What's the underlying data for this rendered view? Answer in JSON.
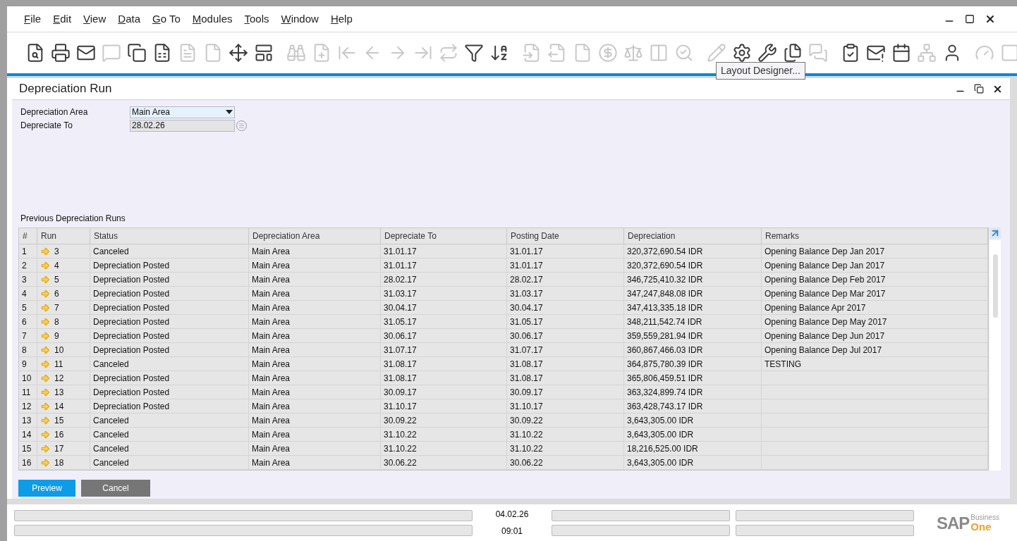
{
  "menu": [
    "File",
    "Edit",
    "View",
    "Data",
    "Go To",
    "Modules",
    "Tools",
    "Window",
    "Help"
  ],
  "toolbar": [
    [
      {
        "disabled": false
      },
      {
        "disabled": false
      },
      {
        "disabled": false
      },
      {
        "disabled": true
      },
      {
        "disabled": false
      },
      {
        "disabled": false
      },
      {
        "disabled": true
      },
      {
        "disabled": true
      },
      {
        "disabled": false
      },
      {
        "disabled": false
      }
    ],
    [
      {
        "disabled": true
      },
      {
        "disabled": true
      },
      {
        "disabled": true
      },
      {
        "disabled": true
      },
      {
        "disabled": true
      },
      {
        "disabled": true
      },
      {
        "disabled": true
      },
      {
        "disabled": false
      },
      {
        "disabled": false
      }
    ],
    [
      {
        "disabled": true
      },
      {
        "disabled": true
      },
      {
        "disabled": true
      },
      {
        "disabled": true
      },
      {
        "disabled": true
      },
      {
        "disabled": true
      },
      {
        "disabled": true
      }
    ],
    [
      {
        "disabled": true
      },
      {
        "disabled": false
      },
      {
        "disabled": false
      },
      {
        "disabled": false
      },
      {
        "disabled": true
      }
    ],
    [
      {
        "disabled": false
      },
      {
        "disabled": false
      },
      {
        "disabled": false
      },
      {
        "disabled": true
      },
      {
        "disabled": false
      }
    ],
    [
      {
        "disabled": true
      },
      {
        "disabled": true
      }
    ]
  ],
  "tooltip": "Layout Designer...",
  "form": {
    "title": "Depreciation Run",
    "fields": [
      {
        "kind": "dropdown",
        "label": "Depreciation Area",
        "value": "Main Area"
      },
      {
        "kind": "date",
        "label": "Depreciate To",
        "value": "28.02.26"
      }
    ],
    "table_title": "Previous Depreciation Runs",
    "columns": [
      "#",
      "Run",
      "Status",
      "Depreciation Area",
      "Depreciate To",
      "Posting Date",
      "Depreciation",
      "Remarks"
    ],
    "rows": [
      [
        "1",
        "3",
        "Canceled",
        "Main Area",
        "31.01.17",
        "31.01.17",
        "320,372,690.54 IDR",
        "Opening Balance Dep Jan 2017"
      ],
      [
        "2",
        "4",
        "Depreciation Posted",
        "Main Area",
        "31.01.17",
        "31.01.17",
        "320,372,690.54 IDR",
        "Opening Balance Dep Jan 2017"
      ],
      [
        "3",
        "5",
        "Depreciation Posted",
        "Main Area",
        "28.02.17",
        "28.02.17",
        "346,725,410.32 IDR",
        "Opening Balance Dep Feb 2017"
      ],
      [
        "4",
        "6",
        "Depreciation Posted",
        "Main Area",
        "31.03.17",
        "31.03.17",
        "347,247,848.08 IDR",
        "Opening Balance Dep Mar 2017"
      ],
      [
        "5",
        "7",
        "Depreciation Posted",
        "Main Area",
        "30.04.17",
        "30.04.17",
        "347,413,335.18 IDR",
        "Opening Balance Apr 2017"
      ],
      [
        "6",
        "8",
        "Depreciation Posted",
        "Main Area",
        "31.05.17",
        "31.05.17",
        "348,211,542.74 IDR",
        "Opening Balance Dep May 2017"
      ],
      [
        "7",
        "9",
        "Depreciation Posted",
        "Main Area",
        "30.06.17",
        "30.06.17",
        "359,559,281.94 IDR",
        "Opening Balance Dep Jun 2017"
      ],
      [
        "8",
        "10",
        "Depreciation Posted",
        "Main Area",
        "31.07.17",
        "31.07.17",
        "360,867,466.03 IDR",
        "Opening Balance Dep Jul 2017"
      ],
      [
        "9",
        "11",
        "Canceled",
        "Main Area",
        "31.08.17",
        "31.08.17",
        "364,875,780.39 IDR",
        "TESTING"
      ],
      [
        "10",
        "12",
        "Depreciation Posted",
        "Main Area",
        "31.08.17",
        "31.08.17",
        "365,806,459.51 IDR",
        ""
      ],
      [
        "11",
        "13",
        "Depreciation Posted",
        "Main Area",
        "30.09.17",
        "30.09.17",
        "363,324,899.74 IDR",
        ""
      ],
      [
        "12",
        "14",
        "Depreciation Posted",
        "Main Area",
        "31.10.17",
        "31.10.17",
        "363,428,743.17 IDR",
        ""
      ],
      [
        "13",
        "15",
        "Canceled",
        "Main Area",
        "30.09.22",
        "30.09.22",
        "3,643,305.00 IDR",
        ""
      ],
      [
        "14",
        "16",
        "Canceled",
        "Main Area",
        "31.10.22",
        "31.10.22",
        "3,643,305.00 IDR",
        ""
      ],
      [
        "15",
        "17",
        "Canceled",
        "Main Area",
        "31.10.22",
        "31.10.22",
        "18,216,525.00 IDR",
        ""
      ],
      [
        "16",
        "18",
        "Canceled",
        "Main Area",
        "30.06.22",
        "30.06.22",
        "3,643,305.00 IDR",
        ""
      ]
    ],
    "buttons": [
      {
        "kind": "primary",
        "label": "Preview"
      },
      {
        "kind": "secondary",
        "label": "Cancel"
      }
    ]
  },
  "status_bar": {
    "date": "04.02.26",
    "time": "09:01",
    "logo": {
      "mark": "SAP",
      "line1": "Business",
      "line2": "One"
    }
  }
}
